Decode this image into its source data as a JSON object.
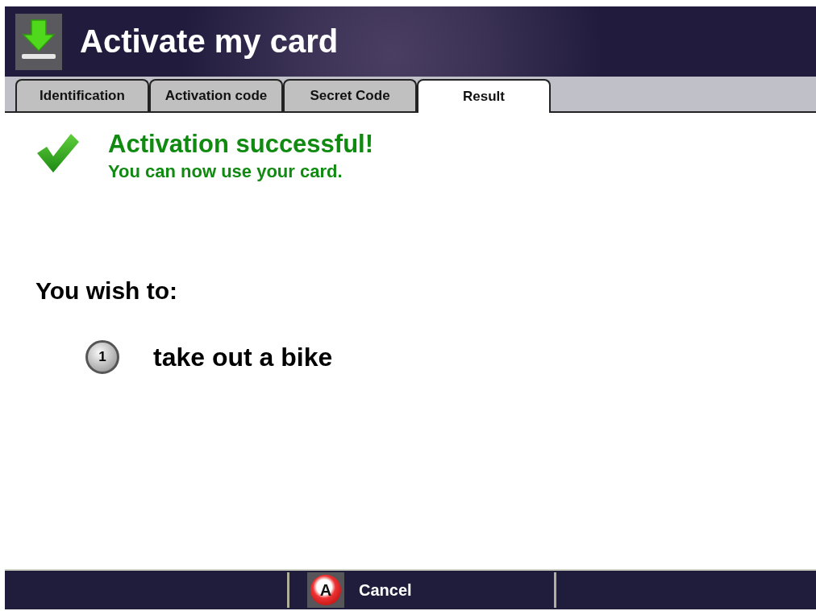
{
  "header": {
    "title": "Activate my card"
  },
  "tabs": [
    {
      "label": "Identification",
      "selected": false
    },
    {
      "label": "Activation code",
      "selected": false
    },
    {
      "label": "Secret Code",
      "selected": false
    },
    {
      "label": "Result",
      "selected": true
    }
  ],
  "result": {
    "heading": "Activation successful!",
    "message": "You can now use your card."
  },
  "options": {
    "prompt": "You wish to:",
    "items": [
      {
        "key": "1",
        "label": "take out a bike"
      }
    ]
  },
  "footer": {
    "buttons": [
      {
        "key": "A",
        "label": "Cancel"
      }
    ]
  }
}
